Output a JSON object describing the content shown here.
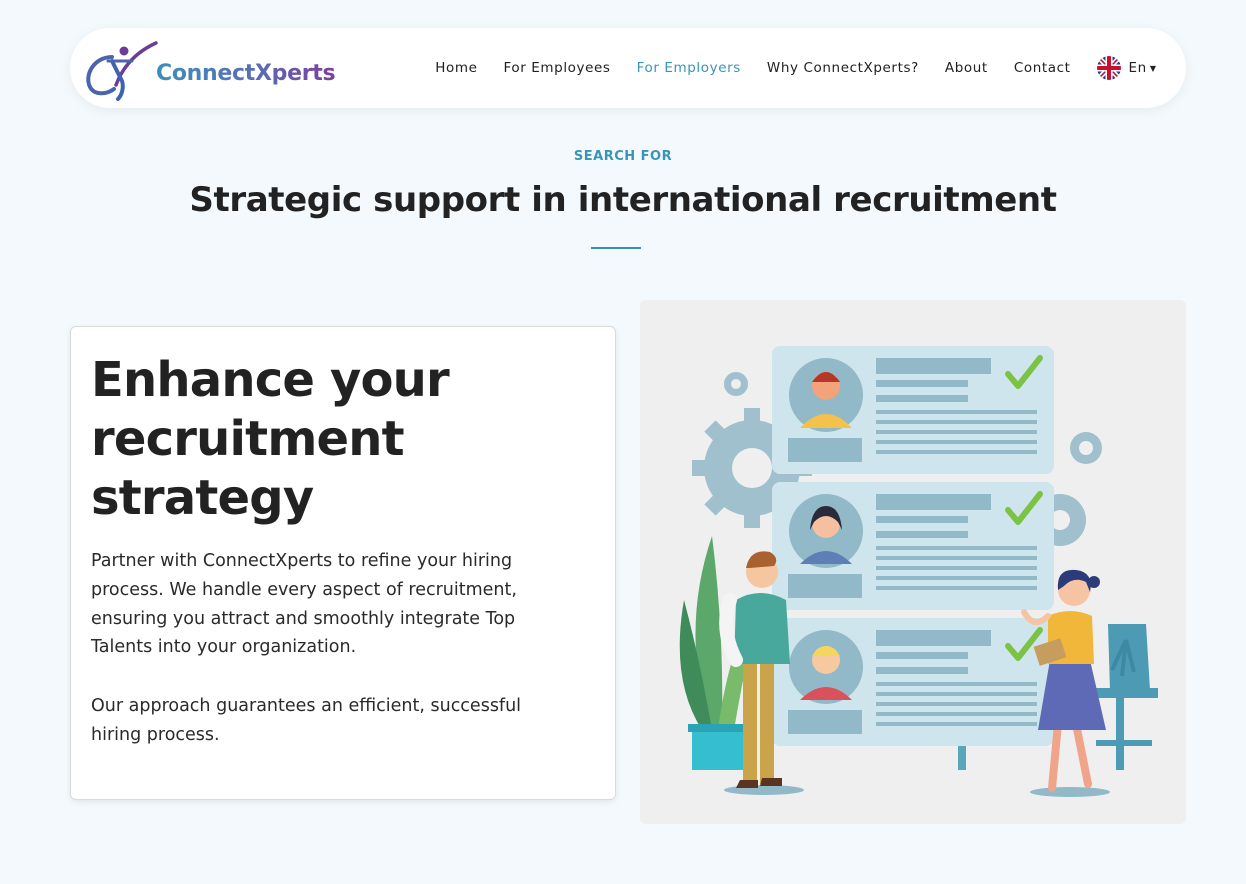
{
  "header": {
    "brand": "ConnectXperts",
    "nav": [
      {
        "label": "Home"
      },
      {
        "label": "For Employees"
      },
      {
        "label": "For Employers"
      },
      {
        "label": "Why ConnectXperts?"
      },
      {
        "label": "About"
      },
      {
        "label": "Contact"
      }
    ],
    "active_nav": "For Employers",
    "language": "En",
    "accent_color": "#3a95b5"
  },
  "section": {
    "eyebrow": "SEARCH FOR",
    "title": "Strategic support in international recruitment"
  },
  "card": {
    "title": "Enhance your recruitment strategy",
    "paragraph1": "Partner with ConnectXperts to refine your hiring process. We handle every aspect of recruitment, ensuring you attract and smoothly integrate Top Talents into your organization.",
    "paragraph2": "Our approach guarantees an efficient, successful hiring process."
  },
  "illustration": {
    "icon": "recruitment-candidates-illustration"
  }
}
